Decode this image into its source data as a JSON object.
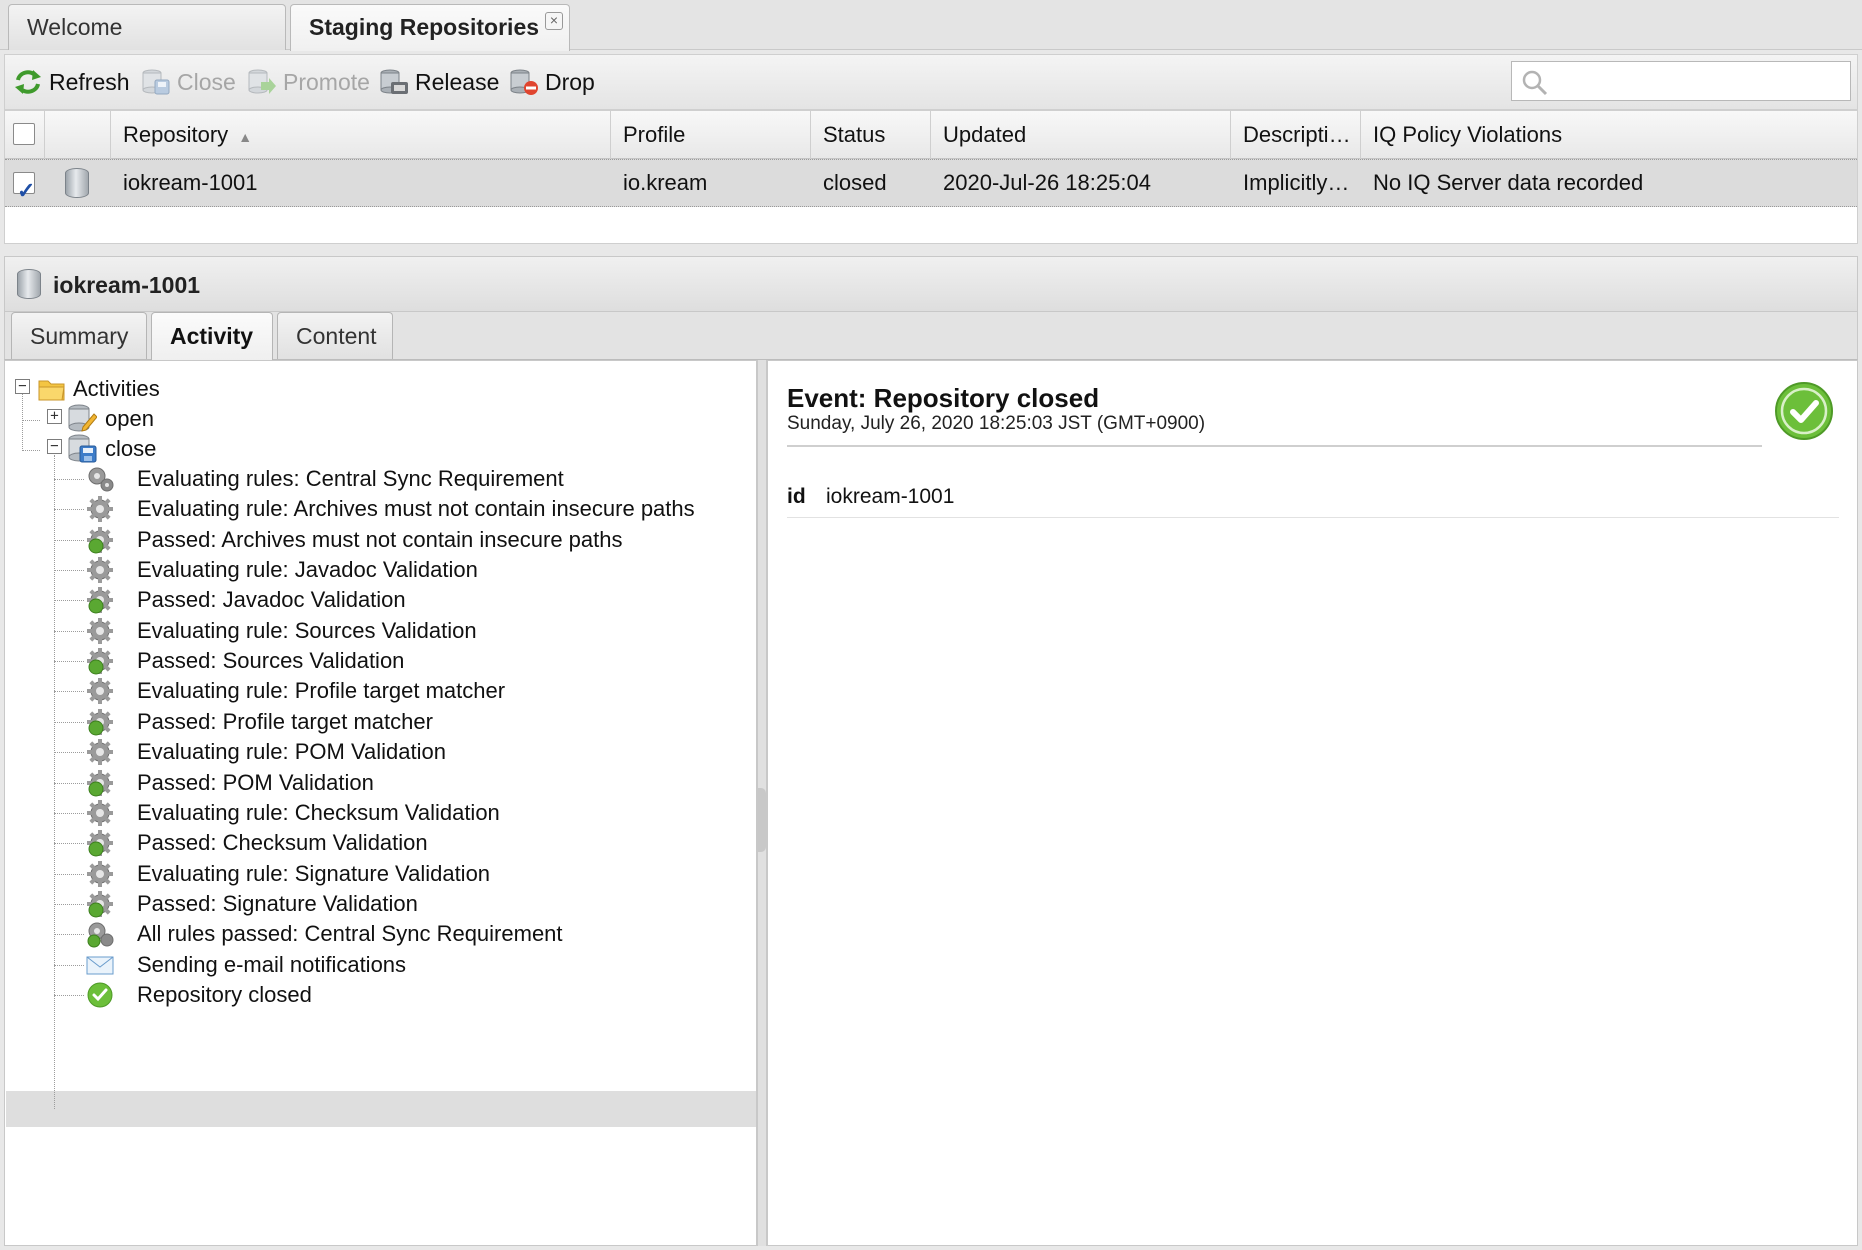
{
  "tabs": {
    "welcome": "Welcome",
    "staging": "Staging Repositories",
    "close_glyph": "×"
  },
  "toolbar": {
    "refresh": "Refresh",
    "close": "Close",
    "promote": "Promote",
    "release": "Release",
    "drop": "Drop",
    "search_placeholder": ""
  },
  "grid": {
    "columns": {
      "repository": "Repository",
      "sort_indicator": "▲",
      "profile": "Profile",
      "status": "Status",
      "updated": "Updated",
      "description": "Descripti…",
      "iq": "IQ Policy Violations"
    },
    "row": {
      "checked": true,
      "repository": "iokream-1001",
      "profile": "io.kream",
      "status": "closed",
      "updated": "2020-Jul-26 18:25:04",
      "description": "Implicitly…",
      "iq": "No IQ Server data recorded"
    }
  },
  "detail": {
    "title": "iokream-1001",
    "tabs": [
      "Summary",
      "Activity",
      "Content"
    ],
    "active_tab": "Activity"
  },
  "tree": {
    "root": "Activities",
    "open": "open",
    "close": "close",
    "items": [
      {
        "label": "Evaluating rules: Central Sync Requirement",
        "icon": "gears-icon"
      },
      {
        "label": "Evaluating rule: Archives must not contain insecure paths",
        "icon": "gear-icon"
      },
      {
        "label": "Passed: Archives must not contain insecure paths",
        "icon": "gear-passed-icon"
      },
      {
        "label": "Evaluating rule: Javadoc Validation",
        "icon": "gear-icon"
      },
      {
        "label": "Passed: Javadoc Validation",
        "icon": "gear-passed-icon"
      },
      {
        "label": "Evaluating rule: Sources Validation",
        "icon": "gear-icon"
      },
      {
        "label": "Passed: Sources Validation",
        "icon": "gear-passed-icon"
      },
      {
        "label": "Evaluating rule: Profile target matcher",
        "icon": "gear-icon"
      },
      {
        "label": "Passed: Profile target matcher",
        "icon": "gear-passed-icon"
      },
      {
        "label": "Evaluating rule: POM Validation",
        "icon": "gear-icon"
      },
      {
        "label": "Passed: POM Validation",
        "icon": "gear-passed-icon"
      },
      {
        "label": "Evaluating rule: Checksum Validation",
        "icon": "gear-icon"
      },
      {
        "label": "Passed: Checksum Validation",
        "icon": "gear-passed-icon"
      },
      {
        "label": "Evaluating rule: Signature Validation",
        "icon": "gear-icon"
      },
      {
        "label": "Passed: Signature Validation",
        "icon": "gear-passed-icon"
      },
      {
        "label": "All rules passed: Central Sync Requirement",
        "icon": "gears-passed-icon"
      },
      {
        "label": "Sending e-mail notifications",
        "icon": "envelope-icon"
      },
      {
        "label": "Repository closed",
        "icon": "check-circle-icon"
      }
    ]
  },
  "event": {
    "title": "Event: Repository closed",
    "date": "Sunday, July 26, 2020 18:25:03 JST (GMT+0900)",
    "prop_key": "id",
    "prop_value": "iokream-1001"
  },
  "colors": {
    "passed_green": "#5aa832",
    "gear_gray": "#8e8e8e",
    "selection_gray": "#dcdcdc"
  }
}
